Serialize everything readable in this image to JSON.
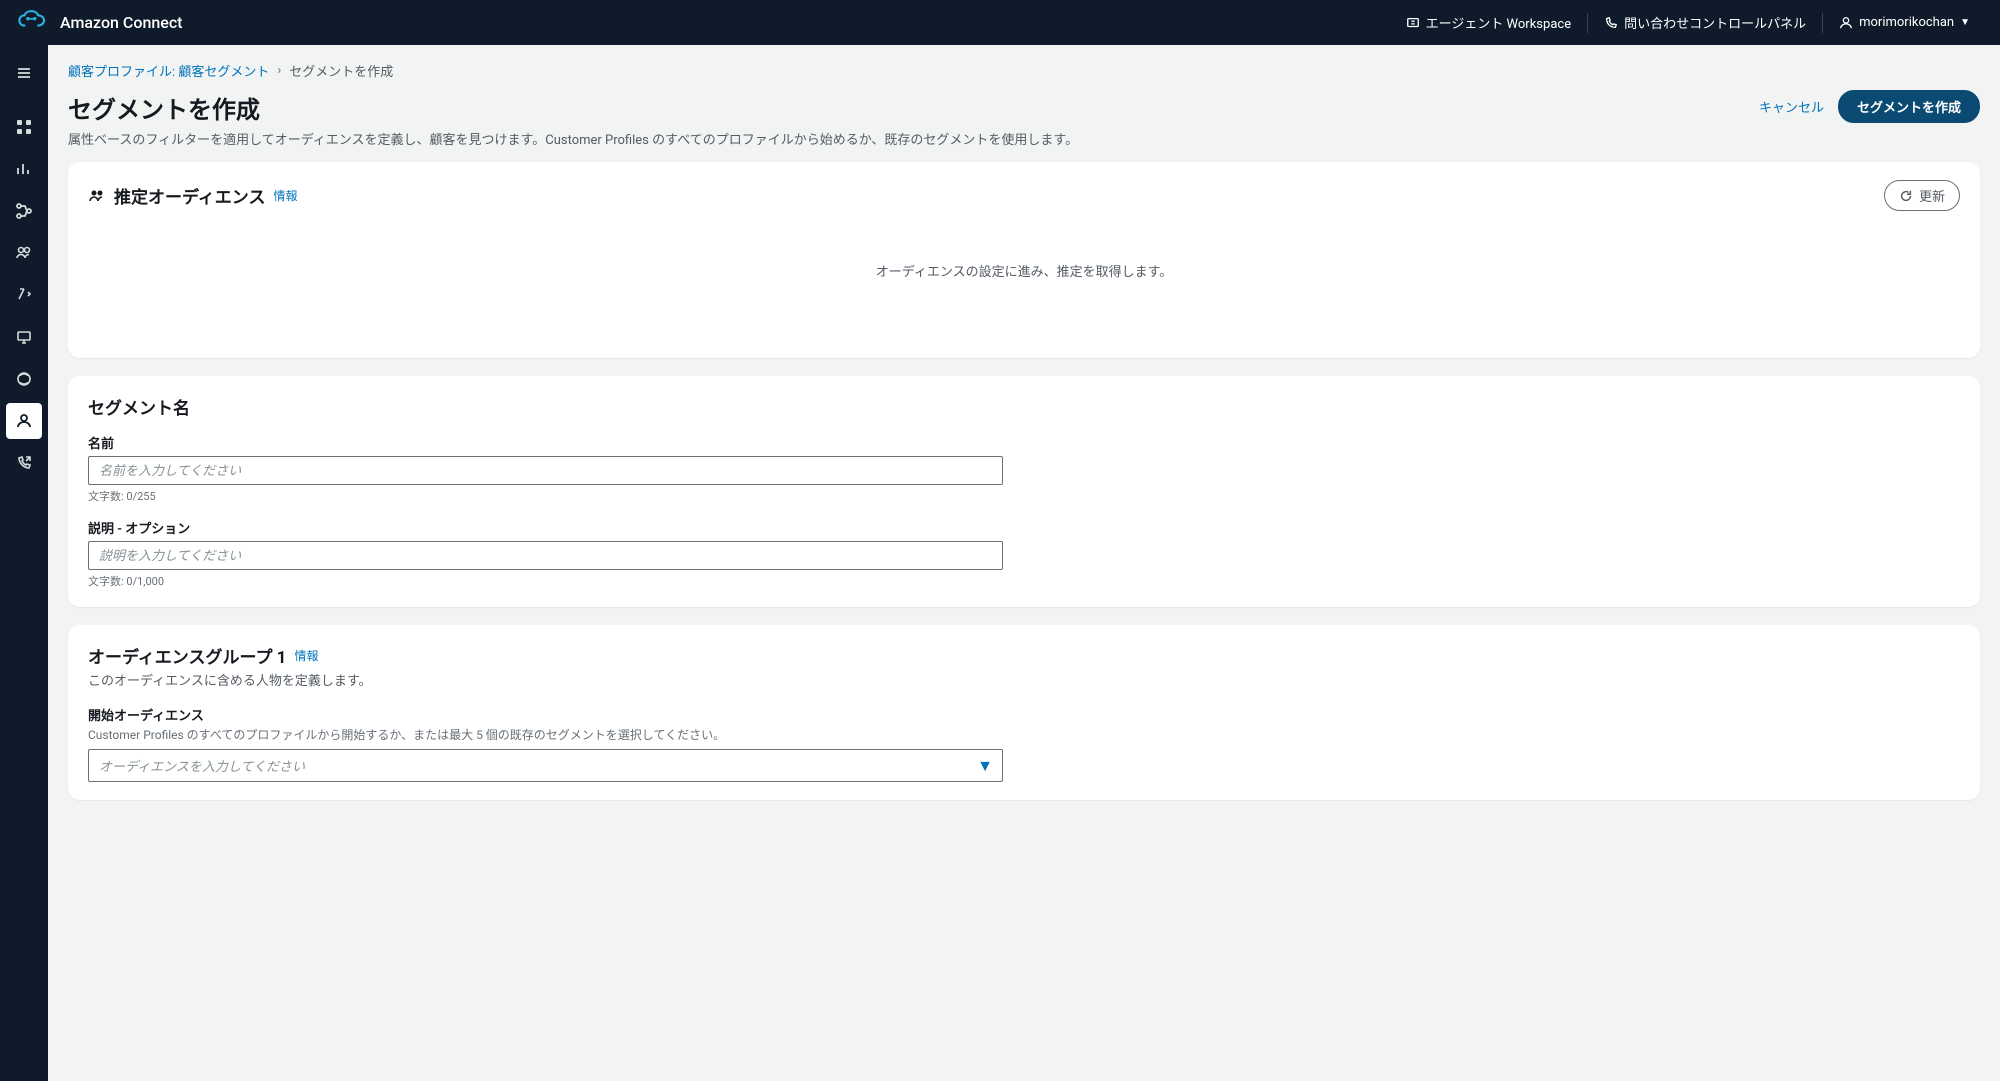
{
  "header": {
    "product": "Amazon Connect",
    "items": {
      "workspace": "エージェント Workspace",
      "ccp": "問い合わせコントロールパネル",
      "user": "morimorikochan"
    }
  },
  "breadcrumb": {
    "parent": "顧客プロファイル: 顧客セグメント",
    "current": "セグメントを作成"
  },
  "page": {
    "title": "セグメントを作成",
    "description": "属性ベースのフィルターを適用してオーディエンスを定義し、顧客を見つけます。Customer Profiles のすべてのプロファイルから始めるか、既存のセグメントを使用します。",
    "cancel": "キャンセル",
    "create": "セグメントを作成"
  },
  "audience": {
    "title": "推定オーディエンス",
    "info": "情報",
    "refresh": "更新",
    "empty": "オーディエンスの設定に進み、推定を取得します。"
  },
  "segmentName": {
    "section": "セグメント名",
    "nameLabel": "名前",
    "namePlaceholder": "名前を入力してください",
    "nameHint": "文字数: 0/255",
    "descLabel": "説明 - オプション",
    "descPlaceholder": "説明を入力してください",
    "descHint": "文字数: 0/1,000"
  },
  "audienceGroup": {
    "title": "オーディエンスグループ 1",
    "info": "情報",
    "desc": "このオーディエンスに含める人物を定義します。",
    "startLabel": "開始オーディエンス",
    "startHint": "Customer Profiles のすべてのプロファイルから開始するか、または最大 5 個の既存のセグメントを選択してください。",
    "startPlaceholder": "オーディエンスを入力してください"
  }
}
